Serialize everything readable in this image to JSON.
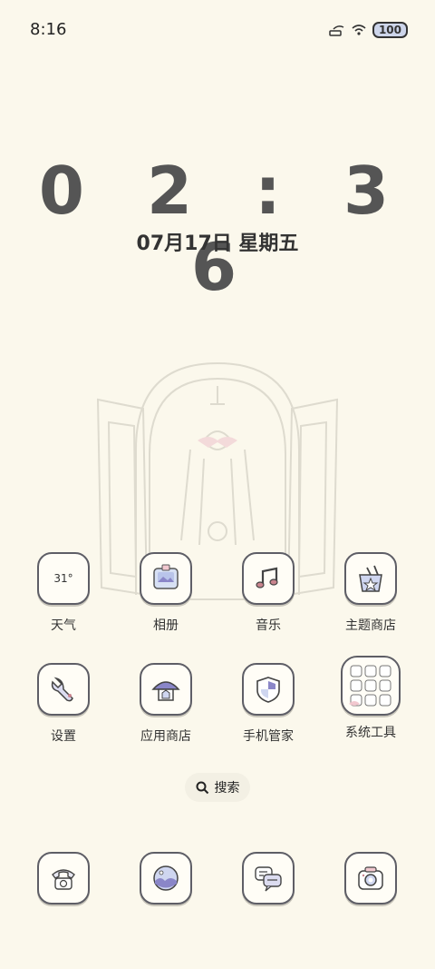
{
  "status_bar": {
    "time": "8:16",
    "battery": "100"
  },
  "lock_clock": {
    "time": "0 2 : 3 6",
    "date": "07月17日 星期五"
  },
  "apps_row1": [
    {
      "label": "天气",
      "icon": "weather-icon",
      "value": "31°"
    },
    {
      "label": "相册",
      "icon": "gallery-icon"
    },
    {
      "label": "音乐",
      "icon": "music-icon"
    },
    {
      "label": "主题商店",
      "icon": "theme-store-icon"
    }
  ],
  "apps_row2": [
    {
      "label": "设置",
      "icon": "settings-icon"
    },
    {
      "label": "应用商店",
      "icon": "app-store-icon"
    },
    {
      "label": "手机管家",
      "icon": "phone-manager-icon"
    },
    {
      "label": "系统工具",
      "icon": "system-tools-folder-icon"
    }
  ],
  "search": {
    "label": "搜索"
  },
  "dock": [
    {
      "icon": "phone-icon"
    },
    {
      "icon": "browser-icon"
    },
    {
      "icon": "messages-icon"
    },
    {
      "icon": "camera-icon"
    }
  ],
  "colors": {
    "background": "#fbf8ec",
    "icon_border": "#5e5e66",
    "accent_purple": "#8a86c8"
  }
}
